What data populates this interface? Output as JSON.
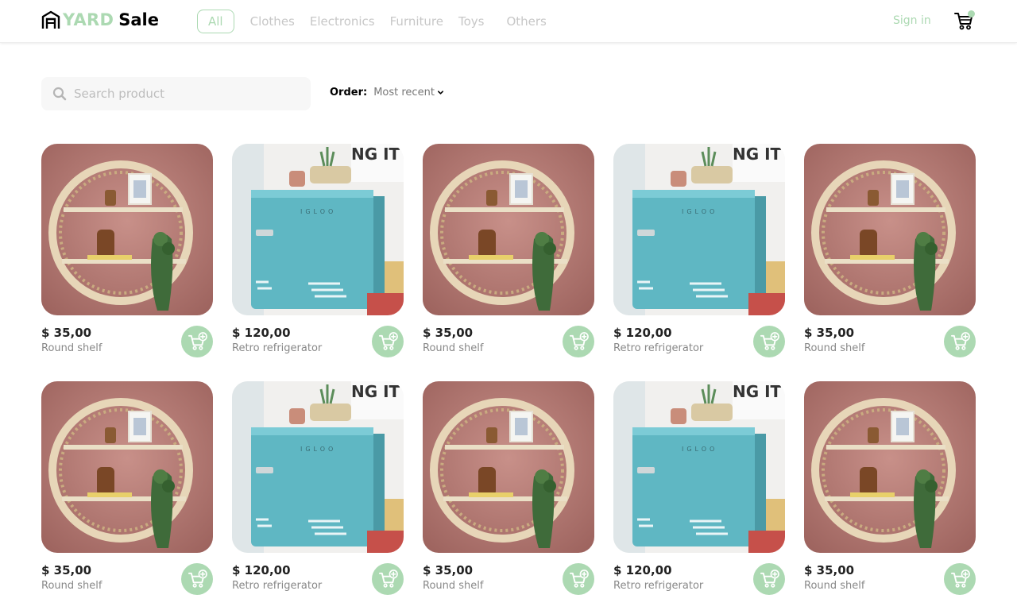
{
  "header": {
    "logo_yard": "YARD",
    "logo_sale": "Sale",
    "nav": [
      {
        "label": "All",
        "active": true
      },
      {
        "label": "Clothes",
        "active": false
      },
      {
        "label": "Electronics",
        "active": false
      },
      {
        "label": "Furniture",
        "active": false
      },
      {
        "label": "Toys",
        "active": false
      },
      {
        "label": "Others",
        "active": false
      }
    ],
    "signin_label": "Sign in",
    "cart_icon": "shopping-cart-icon"
  },
  "toolbar": {
    "search_placeholder": "Search product",
    "order_label": "Order:",
    "order_value": "Most recent"
  },
  "products": [
    {
      "price": "$ 35,00",
      "name": "Round shelf",
      "image": "round-shelf"
    },
    {
      "price": "$ 120,00",
      "name": "Retro refrigerator",
      "image": "retro-fridge"
    },
    {
      "price": "$ 35,00",
      "name": "Round shelf",
      "image": "round-shelf"
    },
    {
      "price": "$ 120,00",
      "name": "Retro refrigerator",
      "image": "retro-fridge"
    },
    {
      "price": "$ 35,00",
      "name": "Round shelf",
      "image": "round-shelf"
    },
    {
      "price": "$ 35,00",
      "name": "Round shelf",
      "image": "round-shelf"
    },
    {
      "price": "$ 120,00",
      "name": "Retro refrigerator",
      "image": "retro-fridge"
    },
    {
      "price": "$ 35,00",
      "name": "Round shelf",
      "image": "round-shelf"
    },
    {
      "price": "$ 120,00",
      "name": "Retro refrigerator",
      "image": "retro-fridge"
    },
    {
      "price": "$ 35,00",
      "name": "Round shelf",
      "image": "round-shelf"
    }
  ],
  "image_text": {
    "fridge_brand": "IGLOO",
    "poster": "NG IT"
  },
  "colors": {
    "accent": "#acd9b2",
    "muted_nav": "#c7c7c7",
    "search_bg": "#f7f7f7",
    "shelf_wall": "#b97a74",
    "fridge_body": "#5fb7c3"
  }
}
